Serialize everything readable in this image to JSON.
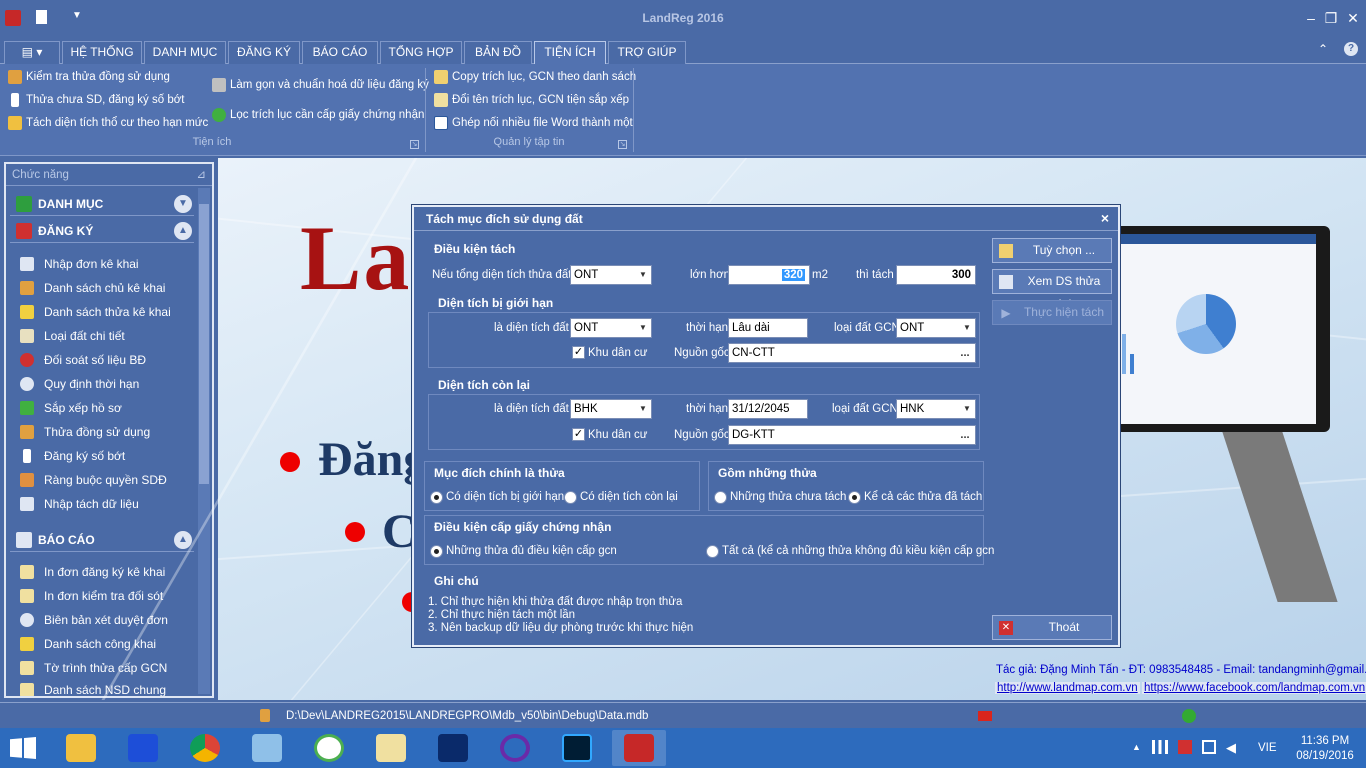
{
  "app": {
    "title": "LandReg 2016"
  },
  "tabs": [
    {
      "label": "HỆ THỐNG"
    },
    {
      "label": "DANH MỤC"
    },
    {
      "label": "ĐĂNG KÝ"
    },
    {
      "label": "BÁO CÁO"
    },
    {
      "label": "TỔNG HỢP"
    },
    {
      "label": "BẢN ĐỒ"
    },
    {
      "label": "TIỆN ÍCH"
    },
    {
      "label": "TRỢ GIÚP"
    }
  ],
  "ribbon": {
    "items": [
      "Kiểm tra thửa đồng sử dụng",
      "Thửa chưa SD, đăng ký số bớt",
      "Tách diện tích thổ cư theo hạn mức",
      "Làm gọn và chuẩn hoá dữ liệu đăng ký",
      "Lọc trích lục cần cấp giấy chứng nhận",
      "Copy trích lục, GCN theo danh sách",
      "Đổi tên trích lục, GCN tiện sắp xếp",
      "Ghép nối nhiều file Word thành một"
    ],
    "groups": [
      "Tiện ích",
      "Quản lý tập tin"
    ]
  },
  "leftpanel": {
    "title": "Chức năng",
    "categories": [
      "DANH MỤC",
      "ĐĂNG KÝ",
      "BÁO CÁO"
    ],
    "dangky_items": [
      "Nhập đơn kê khai",
      "Danh sách chủ kê khai",
      "Danh sách thửa kê khai",
      "Loại đất chi tiết",
      "Đối soát số liệu BĐ",
      "Quy định thời hạn",
      "Sắp xếp hồ sơ",
      "Thửa đồng sử dụng",
      "Đăng ký số bớt",
      "Ràng buộc quyền SDĐ",
      "Nhập tách dữ liệu"
    ],
    "baocao_items": [
      "In đơn đăng ký kê khai",
      "In đơn kiểm tra đối sót",
      "Biên bản xét duyệt đơn",
      "Danh sách công khai",
      "Tờ trình thửa cấp GCN",
      "Danh sách NSD chung"
    ]
  },
  "background": {
    "title": "La",
    "line1": "Đăng",
    "line2": "C"
  },
  "dialog": {
    "title": "Tách mục đích sử dụng đất",
    "close": "×",
    "sec1": "Điều kiện tách",
    "if_total_label": "Nếu tổng diện tích thửa đất",
    "if_total_value": "ONT",
    "greater_label": "lớn hơn",
    "greater_value": "320",
    "unit": "m2",
    "then_label": "thì tách",
    "then_value": "300",
    "sec2": "Diện tích bị giới hạn",
    "limited": {
      "area_label": "là diện tích đất",
      "area_value": "ONT",
      "term_label": "thời hạn",
      "term_value": "Lâu dài",
      "gcn_label": "loại đất GCN",
      "gcn_value": "ONT",
      "residential_label": "Khu dân cư",
      "origin_label": "Nguồn gốc",
      "origin_value": "CN-CTT"
    },
    "sec3": "Diện tích còn lại",
    "remain": {
      "area_label": "là diện tích đất",
      "area_value": "BHK",
      "term_label": "thời hạn",
      "term_value": "31/12/2045",
      "gcn_label": "loại đất GCN",
      "gcn_value": "HNK",
      "residential_label": "Khu dân cư",
      "origin_label": "Nguồn gốc",
      "origin_value": "DG-KTT"
    },
    "sec4": "Mục đích chính là thửa",
    "main_opt1": "Có diện tích bị giới hạn",
    "main_opt2": "Có diện tích còn lại",
    "sec5": "Gồm những thửa",
    "incl_opt1": "Những thửa chưa tách",
    "incl_opt2": "Kể cả các thửa đã tách",
    "sec6": "Điều kiện cấp giấy chứng nhận",
    "cond_opt1": "Những thửa đủ điều kiện cấp gcn",
    "cond_opt2": "Tất cả (kể cả những thửa không đủ kiều kiện cấp gcn",
    "sec7": "Ghi chú",
    "notes": [
      "1. Chỉ thực hiện khi thửa đất được nhập trọn thửa",
      "2. Chỉ thực hiện tách một lần",
      "3. Nên backup dữ liệu dự phòng trước khi thực hiện"
    ],
    "btn_options": "Tuỳ chọn ...",
    "btn_view": "Xem DS thửa tách",
    "btn_run": "Thực hiện tách",
    "btn_exit": "Thoát",
    "ellipsis": "..."
  },
  "credits": {
    "author": "Tác giả: Đặng Minh Tấn - ĐT: 0983548485 - Email: tandangminh@gmail.com",
    "link1": "http://www.landmap.com.vn",
    "link2": "https://www.facebook.com/landmap.com.vn"
  },
  "status": {
    "path": "D:\\Dev\\LANDREG2015\\LANDREGPRO\\Mdb_v50\\bin\\Debug\\Data.mdb"
  },
  "taskbar": {
    "lang": "VIE",
    "time": "11:36 PM",
    "date": "08/19/2016"
  },
  "colors": {
    "window": "#4a6aa6",
    "ribbon": "#5272b0",
    "brand_red": "#a71212",
    "taskbar": "#2d6bbd"
  }
}
